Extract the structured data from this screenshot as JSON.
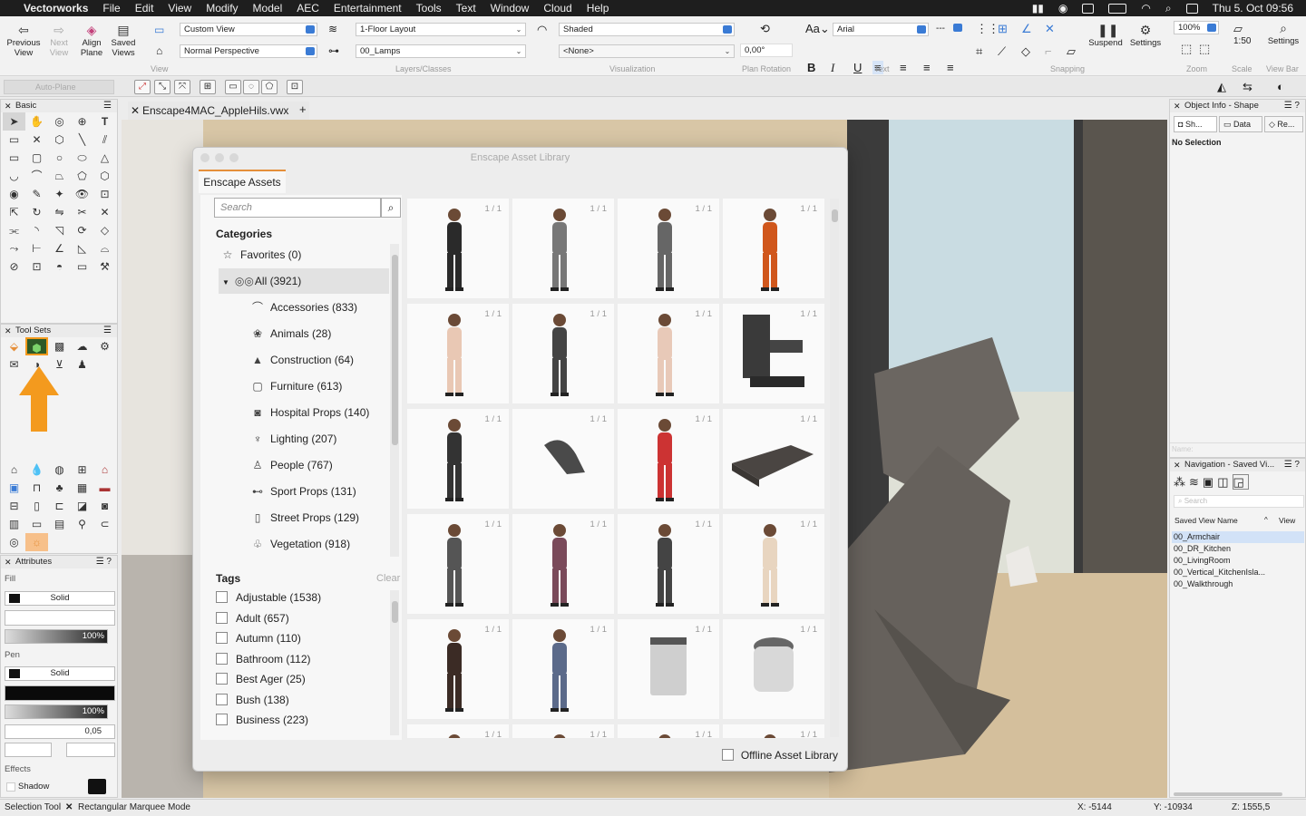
{
  "menubar": {
    "app": "Vectorworks",
    "items": [
      "File",
      "Edit",
      "View",
      "Modify",
      "Model",
      "AEC",
      "Entertainment",
      "Tools",
      "Text",
      "Window",
      "Cloud",
      "Help"
    ],
    "clock": "Thu 5. Oct  09:56"
  },
  "toolbar": {
    "previous_view": "Previous View",
    "next_view": "Next View",
    "align_plane": "Align Plane",
    "saved_views": "Saved Views",
    "view_dd": "Custom View",
    "projection_dd": "Normal Perspective",
    "view_section": "View",
    "layer_dd": "1-Floor Layout",
    "class_dd": "00_Lamps",
    "layers_section": "Layers/Classes",
    "render_dd": "Shaded",
    "render_secondary_dd": "<None>",
    "visualization_section": "Visualization",
    "rotation_value": "0,00°",
    "rotation_section": "Plan Rotation",
    "font_dd": "Arial",
    "text_section": "Text",
    "snapping_section": "Snapping",
    "suspend": "Suspend",
    "settings": "Settings",
    "zoom_value": "100%",
    "zoom_section": "Zoom",
    "scale_value": "1:50",
    "scale_section": "Scale",
    "viewbar_settings": "Settings",
    "viewbar_section": "View Bar"
  },
  "subbar": {
    "auto_plane": "Auto-Plane"
  },
  "basic_palette": {
    "title": "Basic"
  },
  "toolsets_palette": {
    "title": "Tool Sets"
  },
  "attributes": {
    "title": "Attributes",
    "fill_label": "Fill",
    "fill_style": "Solid",
    "fill_opacity": "100%",
    "pen_label": "Pen",
    "pen_style": "Solid",
    "pen_opacity": "100%",
    "line_weight": "0,05",
    "effects_label": "Effects",
    "shadow_label": "Shadow"
  },
  "document_tab": "Enscape4MAC_AppleHils.vwx",
  "dialog": {
    "title": "Enscape Asset Library",
    "tab": "Enscape Assets",
    "search_placeholder": "Search",
    "categories_title": "Categories",
    "categories": [
      {
        "label": "Favorites (0)",
        "icon": "☆"
      },
      {
        "label": "All (3921)",
        "icon": "◎◎"
      },
      {
        "label": "Accessories (833)",
        "icon": "⌒"
      },
      {
        "label": "Animals (28)",
        "icon": "❀"
      },
      {
        "label": "Construction (64)",
        "icon": "▲"
      },
      {
        "label": "Furniture (613)",
        "icon": "▢"
      },
      {
        "label": "Hospital Props (140)",
        "icon": "◙"
      },
      {
        "label": "Lighting (207)",
        "icon": "♆"
      },
      {
        "label": "People (767)",
        "icon": "♙"
      },
      {
        "label": "Sport Props (131)",
        "icon": "⊷"
      },
      {
        "label": "Street Props (129)",
        "icon": "▯"
      },
      {
        "label": "Vegetation (918)",
        "icon": "♧"
      }
    ],
    "tags_title": "Tags",
    "tags_clear": "Clear",
    "tags": [
      "Adjustable (1538)",
      "Adult (657)",
      "Autumn (110)",
      "Bathroom (112)",
      "Best Ager (25)",
      "Bush (138)",
      "Business (223)"
    ],
    "asset_counts": [
      "1 / 1",
      "1 / 1",
      "1 / 1",
      "1 / 1",
      "1 / 1",
      "1 / 1",
      "1 / 1",
      "1 / 1",
      "1 / 1",
      "1 / 1",
      "1 / 1",
      "1 / 1",
      "1 / 1",
      "1 / 1",
      "1 / 1",
      "1 / 1",
      "1 / 1",
      "1 / 1",
      "1 / 1",
      "1 / 1",
      "1 / 1",
      "1 / 1",
      "1 / 1",
      "1 / 1"
    ],
    "offline_label": "Offline Asset Library"
  },
  "object_info": {
    "title": "Object Info - Shape",
    "tab_shape": "Sh...",
    "tab_data": "Data",
    "tab_render": "Re...",
    "status": "No Selection",
    "name_label": "Name:"
  },
  "navigation": {
    "title": "Navigation - Saved Vi...",
    "search_placeholder": "Search",
    "col_name": "Saved View Name",
    "col_view": "View",
    "rows": [
      "00_Armchair",
      "00_DR_Kitchen",
      "00_LivingRoom",
      "00_Vertical_KitchenIsla...",
      "00_Walkthrough"
    ]
  },
  "statusbar": {
    "tool": "Selection Tool",
    "mode": "Rectangular Marquee Mode",
    "x": "X: -5144",
    "y": "Y: -10934",
    "z": "Z: 1555,5"
  },
  "colors": {
    "accent": "#e58f3a",
    "selection": "#3a7bd5",
    "arrow": "#f39a1e"
  }
}
